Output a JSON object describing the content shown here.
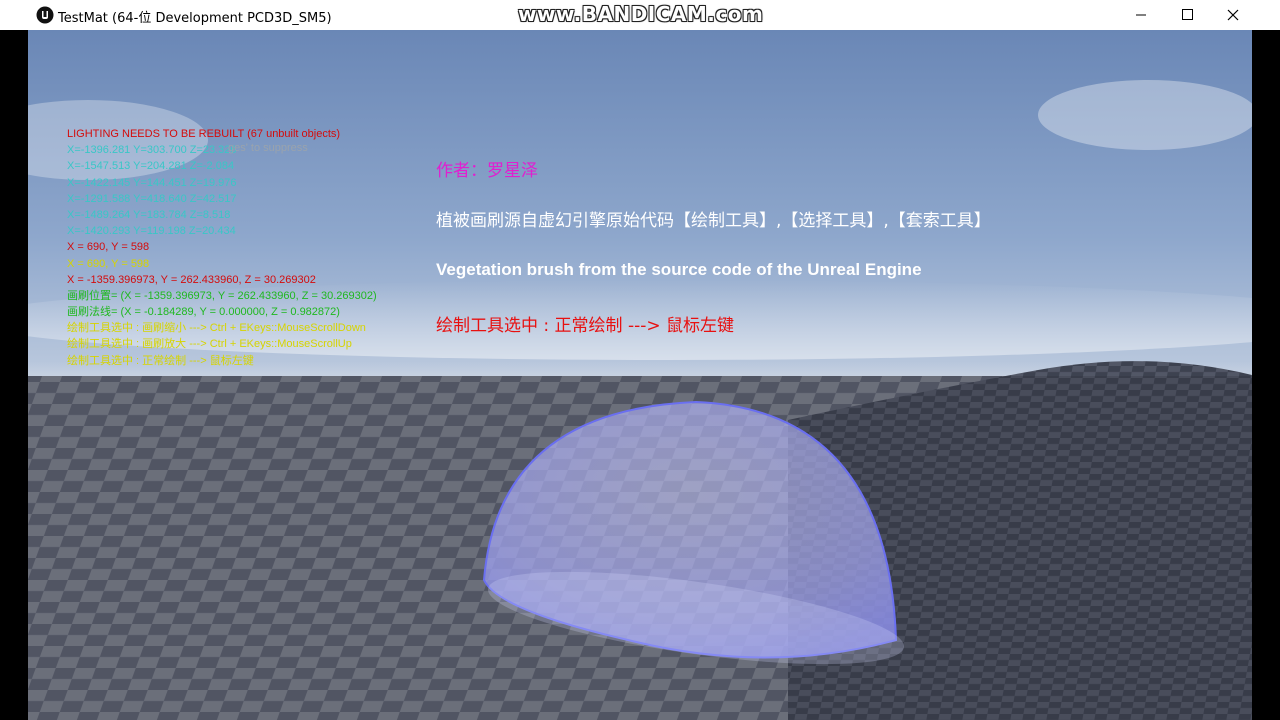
{
  "window": {
    "title": "TestMat   (64-位 Development PCD3D_SM5)",
    "watermark": "www.BANDICAM.com",
    "controls": [
      "minimize",
      "maximize",
      "close"
    ]
  },
  "hud": {
    "warning": "LIGHTING NEEDS TO BE REBUILT (67 unbuilt objects)",
    "suppress_hint": "ges' to suppress",
    "coords": [
      "X=-1396.281 Y=303.700 Z=23.326",
      "X=-1547.513 Y=204.281 Z=-2.084",
      "X=-1422.145 Y=144.451 Z=19.976",
      "X=-1291.588 Y=418.640 Z=42.517",
      "X=-1489.264 Y=183.784 Z=8.518",
      "X=-1420.293 Y=119.198 Z=20.434"
    ],
    "mouse_red": "X = 690, Y = 598",
    "mouse_yellow": "X = 690, Y = 598",
    "hit_pos": "X = -1359.396973, Y = 262.433960, Z = 30.269302",
    "brush_pos": "画刷位置= (X = -1359.396973, Y = 262.433960, Z = 30.269302)",
    "brush_normal": "画刷法线= (X = -0.184289, Y = 0.000000, Z = 0.982872)",
    "hints": [
      "绘制工具选中 : 画刷缩小 ---> Ctrl + EKeys::MouseScrollDown",
      "绘制工具选中 : 画刷放大 ---> Ctrl + EKeys::MouseScrollUp",
      "绘制工具选中 : 正常绘制 ---> 鼠标左键"
    ]
  },
  "notes": {
    "author": "作者：罗星泽",
    "cn_description": "植被画刷源自虚幻引擎原始代码【绘制工具】,【选择工具】,【套索工具】",
    "en_description": "Vegetation brush from the source code of the Unreal Engine",
    "current_tool": "绘制工具选中 : 正常绘制 ---> 鼠标左键"
  },
  "colors": {
    "warning": "#d40c0c",
    "coords": "#39c7c7",
    "hints": "#d6d400",
    "brush": "#1fb81f",
    "author": "#e020d0",
    "tool": "#e81010",
    "dome": "#9aa0ff"
  }
}
